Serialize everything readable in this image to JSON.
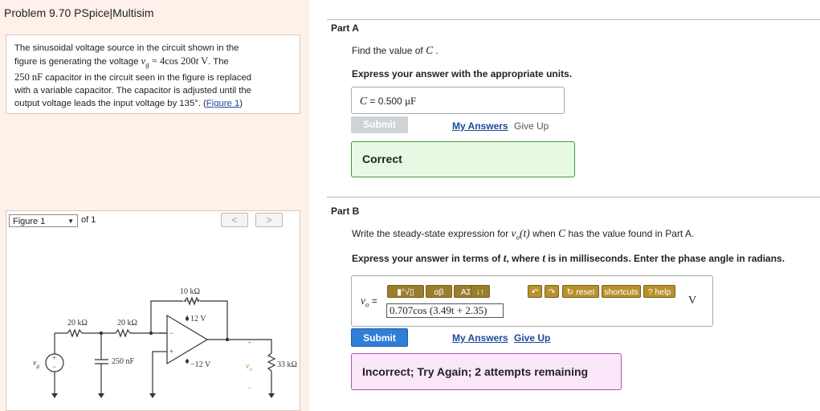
{
  "title": "Problem 9.70 PSpice|Multisim",
  "problem": {
    "line1": "The sinusoidal voltage source in the circuit shown in the",
    "line2_a": "figure is generating the voltage",
    "line2_m": "v",
    "line2_sub": "g",
    "line2_eq": " = 4cos 200",
    "line2_t": "t",
    "line2_v": " V",
    "line2_end": ". The",
    "line3_m": "250 nF",
    "line3_b": " capacitor in the circuit seen in the figure is replaced",
    "line4": "with a variable capacitor. The capacitor is adjusted until the",
    "line5": "output voltage leads the input voltage by 135°. (",
    "figure_link": "Figure 1",
    "line5_end": ")"
  },
  "figure": {
    "select": "Figure 1",
    "of": "of 1",
    "prev": "<",
    "next": ">",
    "labels": {
      "r10k": "10 kΩ",
      "r20k_a": "20 kΩ",
      "r20k_b": "20 kΩ",
      "v12p": "12 V",
      "v12n": "−12 V",
      "cap": "250 nF",
      "r33k": "33 kΩ",
      "vg": "v",
      "vg_sub": "g",
      "vo": "v",
      "vo_sub": "o",
      "plus_src": "+",
      "minus_src": "−",
      "plus_out": "+",
      "minus_out": "−",
      "op_minus": "−",
      "op_plus": "+"
    }
  },
  "partA": {
    "label": "Part A",
    "question_a": "Find the value of ",
    "question_var": "C",
    "question_end": " .",
    "instruction": "Express your answer with the appropriate units.",
    "answer_var": "C",
    "answer_eq": " = ",
    "answer_value": "0.500 ",
    "answer_unit": "μF",
    "submit": "Submit",
    "my_answers": "My Answers",
    "give_up": "Give Up",
    "feedback": "Correct"
  },
  "partB": {
    "label": "Part B",
    "question_a": "Write the steady-state expression for ",
    "question_var": "v",
    "question_sub": "o",
    "question_t": "(t)",
    "question_b": " when ",
    "question_c": "C",
    "question_end": " has the value found in Part A.",
    "instruction_a": "Express your answer in terms of ",
    "instruction_t": "t",
    "instruction_b": ", where ",
    "instruction_t2": "t",
    "instruction_c": " is in milliseconds. Enter the phase angle in radians.",
    "lhs_var": "v",
    "lhs_sub": "o",
    "lhs_eq": " =",
    "toolbar": {
      "t1": "▮°√▯",
      "t2": "αβ",
      "t3": "ΑΣ",
      "t4": "↓↑",
      "undo": "↶",
      "redo": "↷",
      "reset": "reset",
      "shortcuts": "shortcuts",
      "help": "help"
    },
    "math_answer": "0.707cos (3.49t + 2.35)",
    "unit": "V",
    "submit": "Submit",
    "my_answers": "My Answers",
    "give_up": "Give Up",
    "feedback": "Incorrect; Try Again; 2 attempts remaining"
  },
  "colors": {
    "left_bg": "#fdf1ea",
    "correct_bg": "#e8f9e3",
    "correct_border": "#3c9a3c",
    "incorrect_bg": "#fbe6fa",
    "incorrect_border": "#b352b1",
    "submit_blue": "#2f7ed8",
    "link_blue": "#1a4a9a"
  }
}
